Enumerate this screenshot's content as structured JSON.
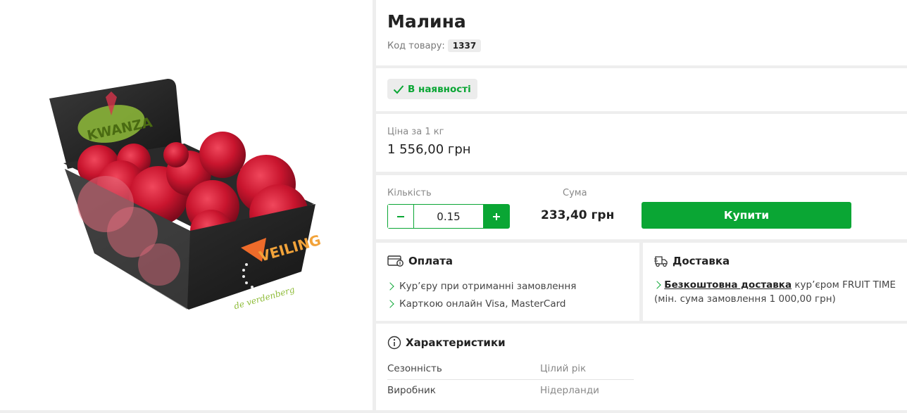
{
  "product": {
    "title": "Малина",
    "code_label": "Код товару:",
    "code": "1337",
    "image_alt": "raspberry-punnet-photo"
  },
  "image": {
    "package_brand": "KWANZA",
    "package_text": "VEILING",
    "package_sub": "de verdenberg"
  },
  "stock": {
    "label": "В наявності",
    "color": "#0aa634"
  },
  "price": {
    "label": "Ціна за 1 кг",
    "value": "1 556,00 грн"
  },
  "purchase": {
    "qty_label": "Кількість",
    "qty_value": "0.15",
    "sum_label": "Сума",
    "sum_value": "233,40 грн",
    "buy_label": "Купити",
    "accent": "#0aa634"
  },
  "payment": {
    "title": "Оплата",
    "items": [
      "Кур’єру при отриманні замовлення",
      "Карткою онлайн Visa, MasterCard"
    ]
  },
  "delivery": {
    "title": "Доставка",
    "link_text": "Безкоштовна доставка",
    "text_after": "кур’єром FRUIT TIME",
    "note": "(мін. сума замовлення 1 000,00 грн)"
  },
  "specs": {
    "title": "Характеристики",
    "rows": [
      {
        "name": "Сезонність",
        "value": "Цілий рік"
      },
      {
        "name": "Виробник",
        "value": "Нідерланди"
      }
    ]
  }
}
